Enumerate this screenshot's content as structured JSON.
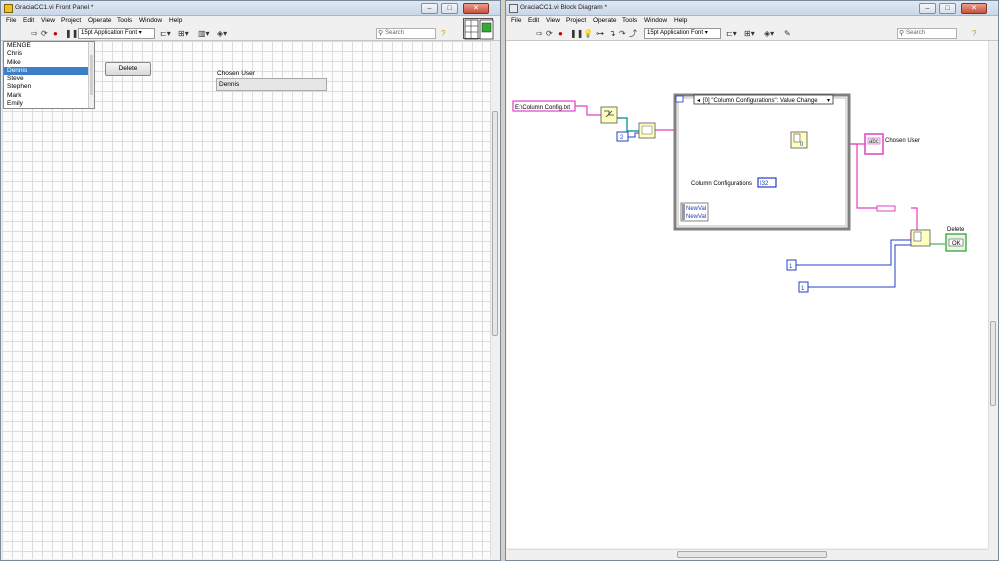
{
  "front_panel": {
    "title": "GraciaCC1.vi Front Panel *",
    "menu": [
      "File",
      "Edit",
      "View",
      "Project",
      "Operate",
      "Tools",
      "Window",
      "Help"
    ],
    "font_selector": "15pt Application Font",
    "search_placeholder": "Search",
    "listbox_items": [
      "MENGE",
      "Chris",
      "Mike",
      "Dennis",
      "Steve",
      "Stephen",
      "Mark",
      "Emily"
    ],
    "listbox_selected": "Dennis",
    "delete_button": "Delete",
    "chosen_user_label": "Chosen User",
    "chosen_user_value": "Dennis"
  },
  "block_diagram": {
    "title": "GraciaCC1.vi Block Diagram *",
    "menu": [
      "File",
      "Edit",
      "View",
      "Project",
      "Operate",
      "Tools",
      "Window",
      "Help"
    ],
    "font_selector": "15pt Application Font",
    "search_placeholder": "Search",
    "file_path_constant": "E:\\Column Config.txt",
    "numeric_constant_2": "2",
    "event_case_selector": "[0] \"Column Configurations\": Value Change",
    "event_case_index": "0",
    "column_configurations_label": "Column Configurations",
    "column_configurations_terminal": "I32",
    "newval_1": "NewVal",
    "newval_2": "NewVal",
    "chosen_user_label": "Chosen User",
    "chosen_user_terminal": "abc",
    "delete_label": "Delete",
    "delete_terminal": "OK",
    "numeric_constant_1a": "1",
    "numeric_constant_1b": "1"
  },
  "colors": {
    "string_wire": "#e040c0",
    "numeric_wire": "#2040c0",
    "bool_wire": "#20a020",
    "selection": "#3c7fc8"
  }
}
